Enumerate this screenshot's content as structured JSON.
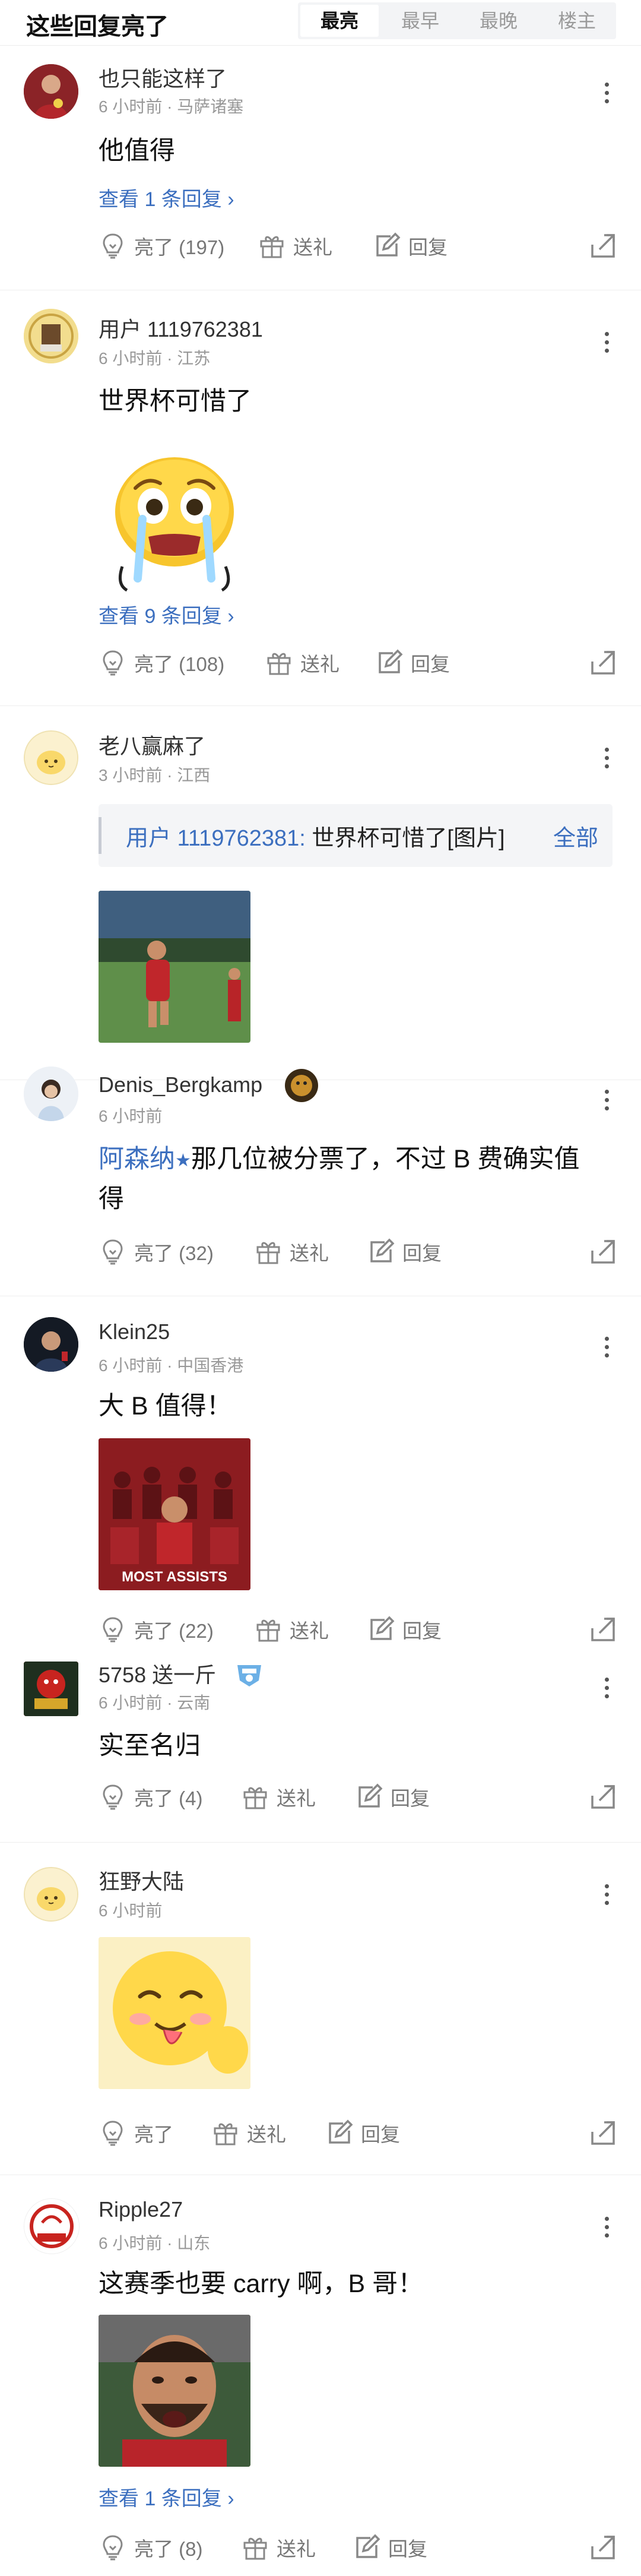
{
  "header": {
    "title": "这些回复亮了",
    "tabs": [
      "最亮",
      "最早",
      "最晚",
      "楼主"
    ],
    "active_tab": "最亮"
  },
  "actions_labels": {
    "send_gift": "送礼",
    "reply": "回复"
  },
  "comments": [
    {
      "username": "也只能这样了",
      "meta": "6 小时前 · 马萨诸塞",
      "text": "他值得",
      "view_replies": "查看 1 条回复 ›",
      "likes": "亮了 (197)"
    },
    {
      "username": "用户 1119762381",
      "meta": "6 小时前 · 江苏",
      "text": "世界杯可惜了",
      "view_replies": "查看 9 条回复 ›",
      "likes": "亮了 (108)"
    },
    {
      "username": "老八赢麻了",
      "meta": "3 小时前 · 江西",
      "quote_user": "用户 1119762381:",
      "quote_text": " 世界杯可惜了[图片]",
      "quote_all": "全部"
    },
    {
      "username": "Denis_Bergkamp",
      "meta": "6 小时前",
      "mention": "阿森纳",
      "text_after_mention": "那几位被分票了，不过 B 费确实值",
      "text_line2": "得",
      "likes": "亮了 (32)"
    },
    {
      "username": "Klein25",
      "meta": "6 小时前 · 中国香港",
      "text": "大 B 值得！",
      "image_caption": "MOST ASSISTS",
      "likes": "亮了 (22)"
    },
    {
      "username": "5758 送一斤",
      "meta": "6 小时前 · 云南",
      "text": "实至名归",
      "likes": "亮了 (4)"
    },
    {
      "username": "狂野大陆",
      "meta": "6 小时前",
      "likes": "亮了"
    },
    {
      "username": "Ripple27",
      "meta": "6 小时前 · 山东",
      "text": "这赛季也要 carry 啊，B 哥！",
      "view_replies": "查看 1 条回复 ›",
      "likes": "亮了 (8)"
    }
  ],
  "colors": {
    "link": "#3c6fbf",
    "muted": "#999999",
    "divider": "#eeeeee"
  }
}
